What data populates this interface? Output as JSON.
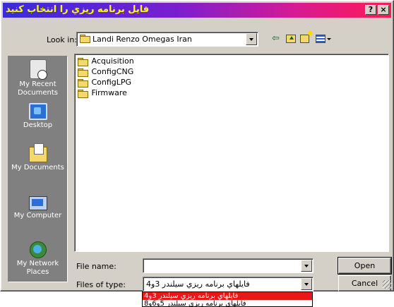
{
  "window": {
    "title": "فايل برنامه ريزي را انتخاب كنيد",
    "help_label": "?",
    "close_label": "×"
  },
  "lookin": {
    "label": "Look in:",
    "value": "Landi Renzo Omegas Iran"
  },
  "toolbar": {
    "back_icon": "back-arrow-icon",
    "up_icon": "up-folder-icon",
    "new_icon": "new-folder-icon",
    "view_icon": "view-menu-icon"
  },
  "places": [
    {
      "label": "My Recent Documents",
      "icon": "recent-documents-icon"
    },
    {
      "label": "Desktop",
      "icon": "desktop-icon"
    },
    {
      "label": "My Documents",
      "icon": "my-documents-icon"
    },
    {
      "label": "My Computer",
      "icon": "my-computer-icon"
    },
    {
      "label": "My Network Places",
      "icon": "network-places-icon"
    }
  ],
  "files": [
    {
      "name": "Acquisition"
    },
    {
      "name": "ConfigCNG"
    },
    {
      "name": "ConfigLPG"
    },
    {
      "name": "Firmware"
    }
  ],
  "filename": {
    "label": "File name:",
    "value": ""
  },
  "filetype": {
    "label": "Files of type:",
    "value": "فايلهاي برنامه ريزي سيلندر 3و4",
    "options": [
      "فايلهاي برنامه ريزي سيلندر 3و4",
      "فايلهاي برنامه ريزي سيلندر 5و6و8"
    ]
  },
  "buttons": {
    "open": "Open",
    "cancel": "Cancel"
  },
  "colors": {
    "title_text": "#ffff00",
    "dropdown_highlight": "#e81818",
    "places_bg": "#808080",
    "dialog_bg": "#d4d0c8"
  }
}
